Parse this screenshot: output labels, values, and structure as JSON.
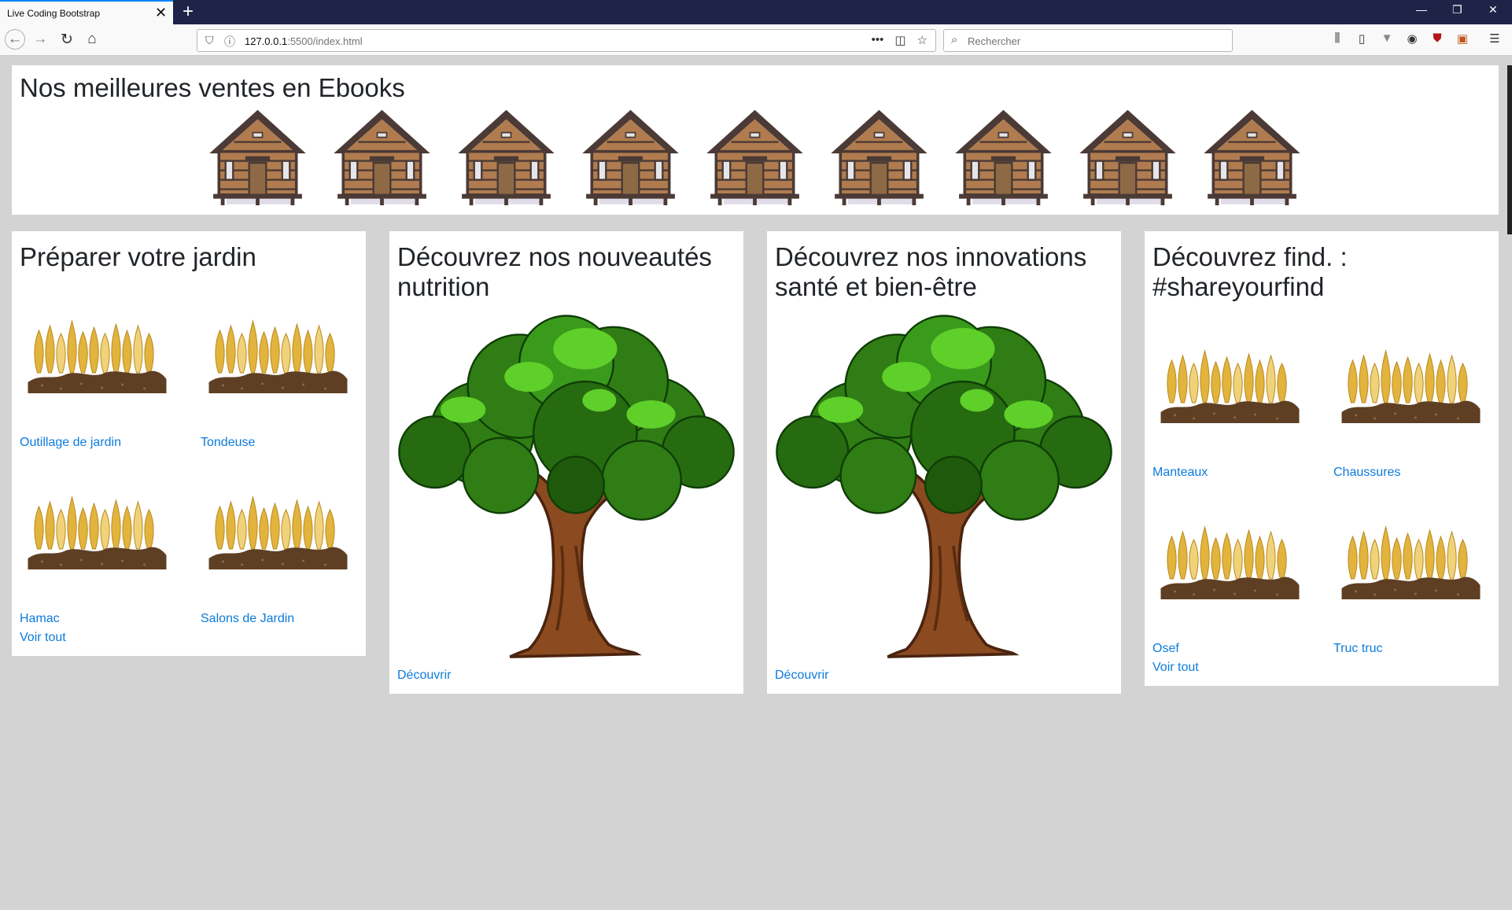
{
  "browser": {
    "tab_title": "Live Coding Bootstrap",
    "url_host": "127.0.0.1",
    "url_path": ":5500/index.html",
    "search_placeholder": "Rechercher"
  },
  "ebooks": {
    "title": "Nos meilleures ventes en Ebooks",
    "house_count": 9
  },
  "garden": {
    "title": "Préparer votre jardin",
    "items": [
      {
        "label": "Outillage de jardin"
      },
      {
        "label": "Tondeuse"
      },
      {
        "label": "Hamac"
      },
      {
        "label": "Salons de Jardin"
      }
    ],
    "see_all": "Voir tout"
  },
  "nutrition": {
    "title_line1": "Découvrez nos nouveautés",
    "title_line2": "nutrition",
    "link": "Découvrir"
  },
  "health": {
    "title_line1": "Découvrez nos innovations",
    "title_line2": "santé et bien-être",
    "link": "Découvrir"
  },
  "find": {
    "title_line1": "Découvrez find. :",
    "title_line2": "#shareyourfind",
    "items": [
      {
        "label": "Manteaux"
      },
      {
        "label": "Chaussures"
      },
      {
        "label": "Osef"
      },
      {
        "label": "Truc truc"
      }
    ],
    "see_all": "Voir tout"
  },
  "colors": {
    "page_bg": "#d3d3d3",
    "link": "#0c7bdc",
    "titlebar": "#1f2347"
  },
  "icons": [
    "house-illustration",
    "wheat-illustration",
    "tree-illustration"
  ]
}
